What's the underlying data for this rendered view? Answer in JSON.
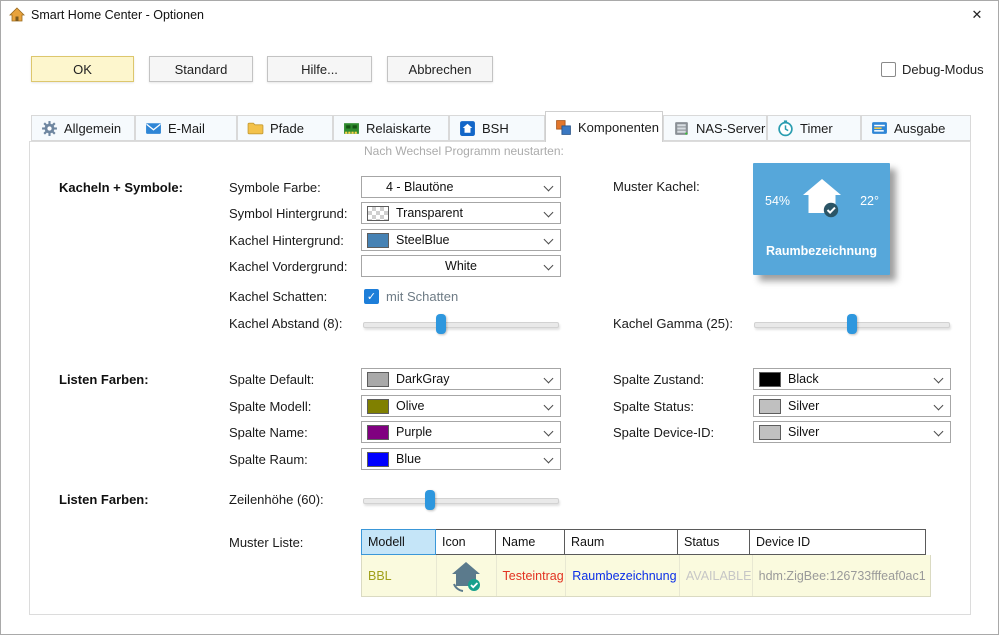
{
  "window": {
    "title": "Smart Home Center - Optionen",
    "close_glyph": "✕"
  },
  "buttons": {
    "ok": "OK",
    "standard": "Standard",
    "hilfe": "Hilfe...",
    "abbrechen": "Abbrechen",
    "debug_label": "Debug-Modus"
  },
  "tabs": [
    {
      "label": "Allgemein"
    },
    {
      "label": "E-Mail"
    },
    {
      "label": "Pfade"
    },
    {
      "label": "Relaiskarte"
    },
    {
      "label": "BSH"
    },
    {
      "label": "Komponenten",
      "selected": true
    },
    {
      "label": "NAS-Server"
    },
    {
      "label": "Timer"
    },
    {
      "label": "Ausgabe"
    }
  ],
  "content": {
    "restart_hint": "Nach Wechsel Programm neustarten:",
    "group_kacheln": "Kacheln + Symbole:",
    "group_listen1": "Listen Farben:",
    "group_listen2": "Listen Farben:",
    "fields": {
      "symbole_farbe": {
        "label": "Symbole Farbe:",
        "value": "4 - Blautöne"
      },
      "symbol_hintergrund": {
        "label": "Symbol Hintergrund:",
        "value": "Transparent"
      },
      "kachel_hintergrund": {
        "label": "Kachel Hintergrund:",
        "value": "SteelBlue",
        "swatch": "#4682B4"
      },
      "kachel_vordergrund": {
        "label": "Kachel Vordergrund:",
        "value": "White"
      },
      "kachel_schatten": {
        "label": "Kachel Schatten:",
        "checkbox_label": "mit Schatten",
        "checked": true,
        "check_glyph": "✓"
      },
      "kachel_abstand": {
        "label": "Kachel Abstand (8):",
        "thumb_left": "40%"
      },
      "kachel_gamma": {
        "label": "Kachel Gamma (25):",
        "thumb_left": "50%"
      },
      "muster_kachel_label": "Muster Kachel:",
      "spalte_default": {
        "label": "Spalte Default:",
        "value": "DarkGray",
        "swatch": "#A9A9A9"
      },
      "spalte_modell": {
        "label": "Spalte Modell:",
        "value": "Olive",
        "swatch": "#808000"
      },
      "spalte_name": {
        "label": "Spalte Name:",
        "value": "Purple",
        "swatch": "#800080"
      },
      "spalte_raum": {
        "label": "Spalte Raum:",
        "value": "Blue",
        "swatch": "#0000FF"
      },
      "spalte_zustand": {
        "label": "Spalte Zustand:",
        "value": "Black",
        "swatch": "#000000"
      },
      "spalte_status": {
        "label": "Spalte Status:",
        "value": "Silver",
        "swatch": "#C0C0C0"
      },
      "spalte_device": {
        "label": "Spalte Device-ID:",
        "value": "Silver",
        "swatch": "#C0C0C0"
      },
      "zeilenhoehe": {
        "label": "Zeilenhöhe (60):",
        "thumb_left": "34%"
      },
      "muster_liste_label": "Muster Liste:"
    },
    "tile": {
      "bg": "#56a7da",
      "humidity": "54%",
      "temperature": "22°",
      "room": "Raumbezeichnung"
    },
    "table": {
      "headers": [
        "Modell",
        "Icon",
        "Name",
        "Raum",
        "Status",
        "Device ID"
      ],
      "row": {
        "modell": "BBL",
        "name": "Testeintrag",
        "raum": "Raumbezeichnung",
        "status": "AVAILABLE",
        "device_id": "hdm:ZigBee:126733fffeaf0ac1"
      },
      "row_colors": {
        "modell": "#a0a018",
        "name": "#e23322",
        "raum": "#0b2fe8",
        "status": "#c6c6c6",
        "device_id": "#9a9a9a"
      }
    }
  }
}
